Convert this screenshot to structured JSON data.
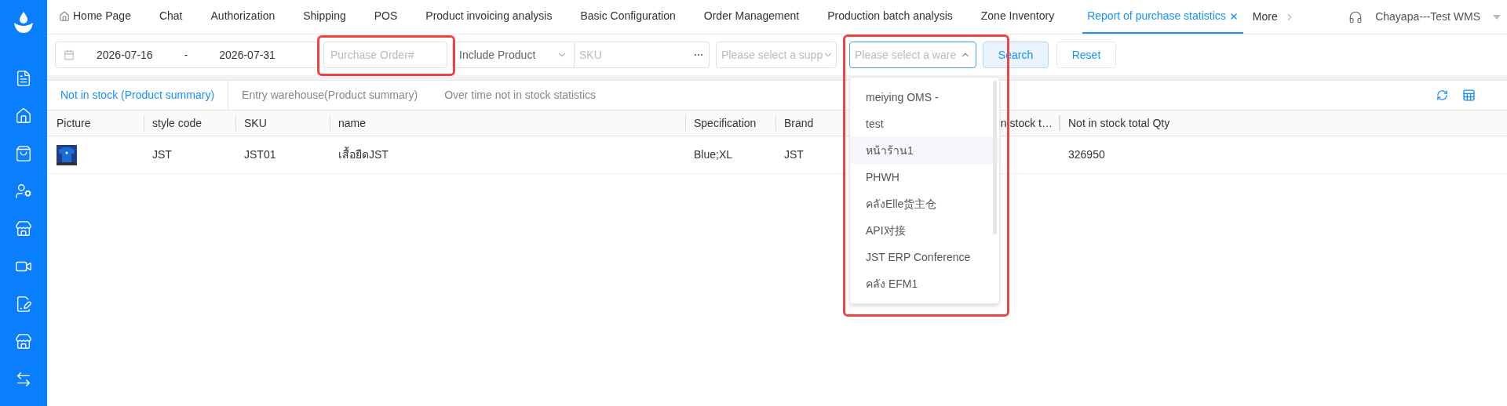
{
  "nav": {
    "tabs": [
      {
        "label": "Home Page",
        "selected": false,
        "kind": "home"
      },
      {
        "label": "Chat",
        "selected": false
      },
      {
        "label": "Authorization",
        "selected": false
      },
      {
        "label": "Shipping",
        "selected": false
      },
      {
        "label": "POS",
        "selected": false
      },
      {
        "label": "Product invoicing analysis",
        "selected": false
      },
      {
        "label": "Basic Configuration",
        "selected": false
      },
      {
        "label": "Order Management",
        "selected": false
      },
      {
        "label": "Production batch analysis",
        "selected": false
      },
      {
        "label": "Zone Inventory",
        "selected": false
      },
      {
        "label": "Report of purchase statistics",
        "selected": true,
        "closable": true
      }
    ],
    "more": "More",
    "user": "Chayapa---Test WMS"
  },
  "filters": {
    "date_from": "2026-07-16",
    "date_separator": "-",
    "date_to": "2026-07-31",
    "purchase_order": {
      "placeholder": "Purchase Order#",
      "highlighted": true
    },
    "include_product": {
      "value": "Include Product"
    },
    "sku": {
      "placeholder": "SKU"
    },
    "supplier": {
      "placeholder": "Please select a supp"
    },
    "warehouse": {
      "placeholder": "Please select a ware",
      "open": true,
      "highlighted": true,
      "options": [
        {
          "label": "meiying OMS -",
          "hovered": false
        },
        {
          "label": "test",
          "hovered": false
        },
        {
          "label": "หน้าร้าน1",
          "hovered": true
        },
        {
          "label": "PHWH",
          "hovered": false
        },
        {
          "label": "คลังElle货主仓",
          "hovered": false
        },
        {
          "label": "API对接",
          "hovered": false
        },
        {
          "label": "JST ERP Conference",
          "hovered": false
        },
        {
          "label": "คลัง EFM1",
          "hovered": false
        }
      ]
    },
    "buttons": [
      {
        "label": "Search",
        "kind": "primary"
      },
      {
        "label": "Reset",
        "kind": "default"
      }
    ]
  },
  "report_tabs": [
    {
      "label": "Not in stock (Product summary)",
      "selected": true
    },
    {
      "label": "Entry warehouse(Product summary)",
      "selected": false
    },
    {
      "label": "Over time not in stock statistics",
      "selected": false
    }
  ],
  "table": {
    "columns": [
      "Picture",
      "style code",
      "SKU",
      "name",
      "Specification",
      "Brand",
      "n stock t…",
      "Not in stock total Qty"
    ],
    "rows": [
      {
        "cells": [
          "",
          "JST",
          "JST01",
          "เสื้อยืดJST",
          "Blue;XL",
          "JST",
          "",
          "326950"
        ]
      }
    ]
  }
}
